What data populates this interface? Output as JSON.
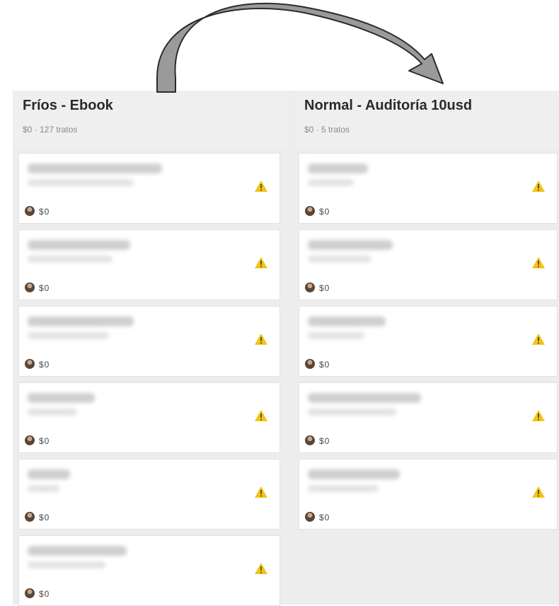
{
  "columns": [
    {
      "title": "Fríos - Ebook",
      "meta": "$0 · 127 tratos",
      "cards": [
        {
          "value": "$0"
        },
        {
          "value": "$0"
        },
        {
          "value": "$0"
        },
        {
          "value": "$0"
        },
        {
          "value": "$0"
        },
        {
          "value": "$0"
        }
      ]
    },
    {
      "title": "Normal - Auditoría 10usd",
      "meta": "$0 · 5 tratos",
      "cards": [
        {
          "value": "$0"
        },
        {
          "value": "$0"
        },
        {
          "value": "$0"
        },
        {
          "value": "$0"
        },
        {
          "value": "$0"
        }
      ]
    }
  ],
  "colors": {
    "board_bg": "#ededed",
    "card_bg": "#ffffff",
    "warning": "#f0c419",
    "arrow_fill": "#9a9a9a"
  },
  "icons": {
    "warning": "warning-triangle-icon",
    "avatar": "user-avatar",
    "annotation": "curved-arrow"
  }
}
